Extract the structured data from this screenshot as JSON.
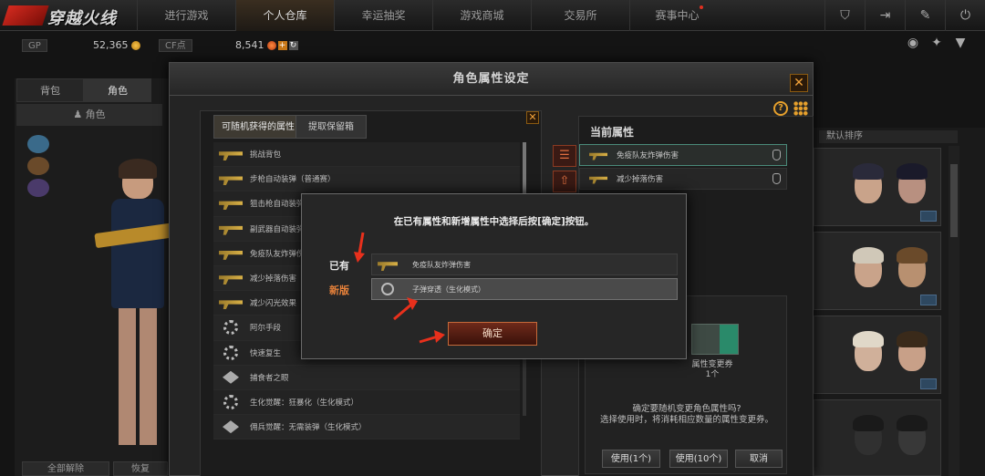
{
  "nav": {
    "logo_text": "穿越火线",
    "tabs": [
      {
        "label": "进行游戏"
      },
      {
        "label": "个人仓库"
      },
      {
        "label": "幸运抽奖"
      },
      {
        "label": "游戏商城"
      },
      {
        "label": "交易所"
      },
      {
        "label": "赛事中心"
      }
    ]
  },
  "currency": {
    "gp_label": "GP",
    "gp_value": "52,365",
    "cf_label": "CF点",
    "cf_value": "8,541"
  },
  "left": {
    "tab_bag": "背包",
    "tab_role": "角色",
    "role_bar": "角色",
    "btn_all": "全部解除",
    "btn_restore": "恢复"
  },
  "right": {
    "sort_label": "默认排序"
  },
  "modal": {
    "title": "角色属性设定",
    "available": {
      "tab_random": "可随机获得的属性",
      "tab_extract": "提取保留箱",
      "items": [
        {
          "text": "挑战背包",
          "icon": "gun"
        },
        {
          "text": "步枪自动装弹（普通赛）",
          "icon": "gun"
        },
        {
          "text": "狙击枪自动装弹",
          "icon": "gun"
        },
        {
          "text": "副武器自动装弹",
          "icon": "gun"
        },
        {
          "text": "免疫队友炸弹伤害",
          "icon": "gun"
        },
        {
          "text": "减少掉落伤害",
          "icon": "gun"
        },
        {
          "text": "减少闪光效果",
          "icon": "gun"
        },
        {
          "text": "阿尔手段",
          "icon": "gear"
        },
        {
          "text": "快速复生",
          "icon": "gear"
        },
        {
          "text": "捕食者之眼",
          "icon": "wing"
        },
        {
          "text": "生化觉醒：狂暴化（生化模式）",
          "icon": "gear"
        },
        {
          "text": "佣兵觉醒：无需装弹（生化模式）",
          "icon": "wing"
        }
      ]
    },
    "current": {
      "title": "当前属性",
      "items": [
        {
          "text": "免疫队友炸弹伤害"
        },
        {
          "text": "减少掉落伤害"
        }
      ],
      "voucher_name": "属性变更券",
      "voucher_count": "1个",
      "prompt_line1": "确定要随机变更角色属性吗?",
      "prompt_line2": "选择使用时，将消耗相应数量的属性变更券。",
      "btn_use1": "使用(1个)",
      "btn_use10": "使用(10个)",
      "btn_cancel": "取消"
    }
  },
  "dialog": {
    "message": "在已有属性和新增属性中选择后按[确定]按钮。",
    "label_existing": "已有",
    "label_new": "新版",
    "existing_attr": "免疫队友炸弹伤害",
    "new_attr": "子弹穿透（生化模式）",
    "confirm": "确定"
  },
  "colors": {
    "accent_orange": "#e6a02c",
    "new_label": "#e8823a",
    "annotation_red": "#e8301c"
  }
}
